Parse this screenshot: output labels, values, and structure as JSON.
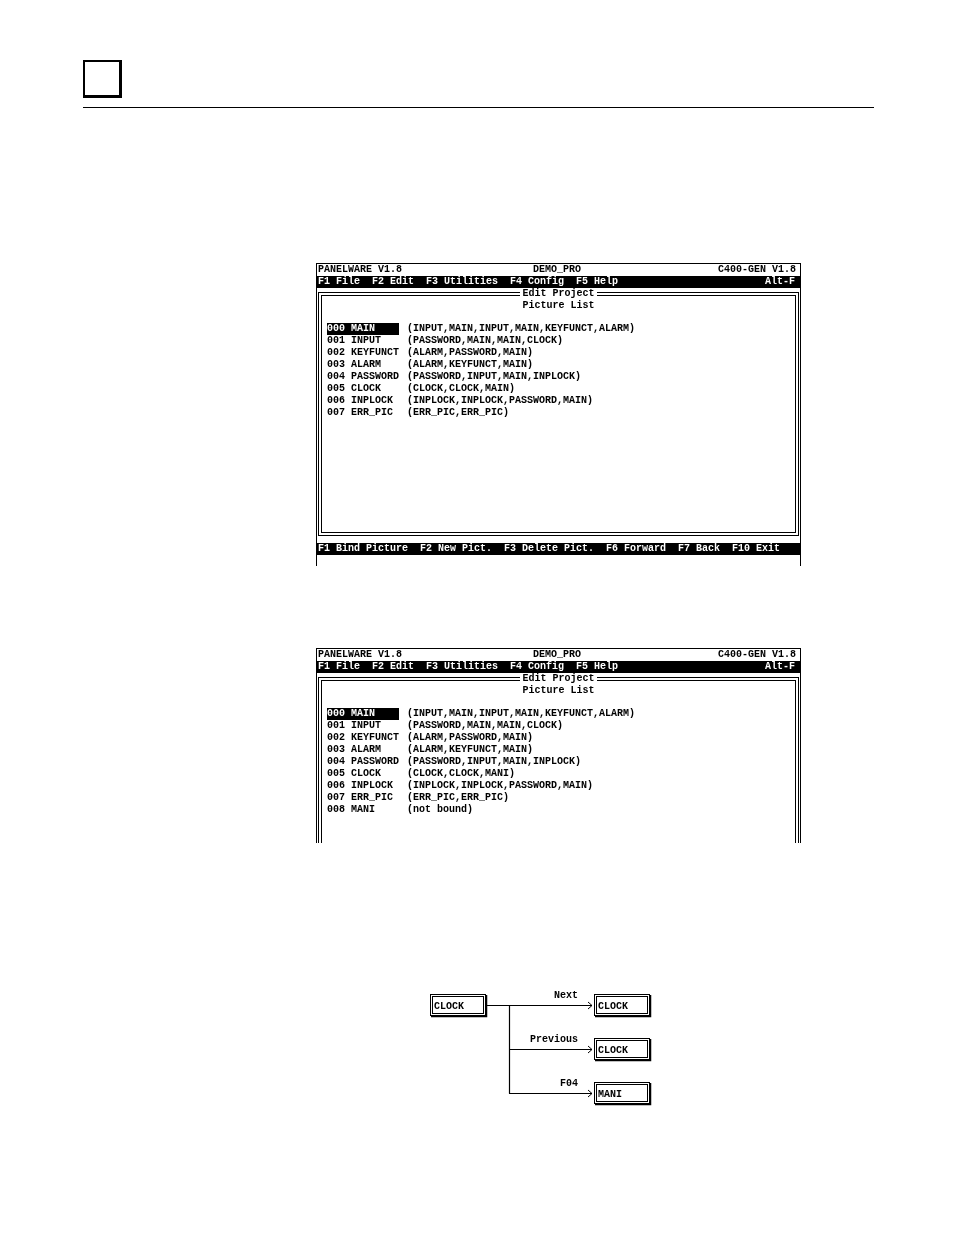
{
  "screens": [
    {
      "title_bar": {
        "app": "PANELWARE V1.8",
        "project": "DEMO_PRO",
        "target": "C400-GEN V1.8"
      },
      "menu": {
        "items": [
          "F1 File",
          "F2 Edit",
          "F3 Utilities",
          "F4 Config",
          "F5 Help"
        ],
        "shortcut": "Alt-F"
      },
      "panel": {
        "title": "Edit Project",
        "heading": "Picture List",
        "pictures": [
          {
            "number": "000",
            "name": "MAIN",
            "links": "(INPUT,MAIN,INPUT,MAIN,KEYFUNCT,ALARM)",
            "selected": true
          },
          {
            "number": "001",
            "name": "INPUT",
            "links": "(PASSWORD,MAIN,MAIN,CLOCK)",
            "selected": false
          },
          {
            "number": "002",
            "name": "KEYFUNCT",
            "links": "(ALARM,PASSWORD,MAIN)",
            "selected": false
          },
          {
            "number": "003",
            "name": "ALARM",
            "links": "(ALARM,KEYFUNCT,MAIN)",
            "selected": false
          },
          {
            "number": "004",
            "name": "PASSWORD",
            "links": "(PASSWORD,INPUT,MAIN,INPLOCK)",
            "selected": false
          },
          {
            "number": "005",
            "name": "CLOCK",
            "links": "(CLOCK,CLOCK,MAIN)",
            "selected": false
          },
          {
            "number": "006",
            "name": "INPLOCK",
            "links": "(INPLOCK,INPLOCK,PASSWORD,MAIN)",
            "selected": false
          },
          {
            "number": "007",
            "name": "ERR_PIC",
            "links": "(ERR_PIC,ERR_PIC)",
            "selected": false
          }
        ]
      },
      "function_keys": [
        "F1 Bind Picture",
        "F2 New Pict.",
        "F3 Delete Pict.",
        "F6 Forward",
        "F7 Back",
        "F10 Exit"
      ]
    },
    {
      "title_bar": {
        "app": "PANELWARE V1.8",
        "project": "DEMO_PRO",
        "target": "C400-GEN V1.8"
      },
      "menu": {
        "items": [
          "F1 File",
          "F2 Edit",
          "F3 Utilities",
          "F4 Config",
          "F5 Help"
        ],
        "shortcut": "Alt-F"
      },
      "panel": {
        "title": "Edit Project",
        "heading": "Picture List",
        "pictures": [
          {
            "number": "000",
            "name": "MAIN",
            "links": "(INPUT,MAIN,INPUT,MAIN,KEYFUNCT,ALARM)",
            "selected": true
          },
          {
            "number": "001",
            "name": "INPUT",
            "links": "(PASSWORD,MAIN,MAIN,CLOCK)",
            "selected": false
          },
          {
            "number": "002",
            "name": "KEYFUNCT",
            "links": "(ALARM,PASSWORD,MAIN)",
            "selected": false
          },
          {
            "number": "003",
            "name": "ALARM",
            "links": "(ALARM,KEYFUNCT,MAIN)",
            "selected": false
          },
          {
            "number": "004",
            "name": "PASSWORD",
            "links": "(PASSWORD,INPUT,MAIN,INPLOCK)",
            "selected": false
          },
          {
            "number": "005",
            "name": "CLOCK",
            "links": "(CLOCK,CLOCK,MANI)",
            "selected": false
          },
          {
            "number": "006",
            "name": "INPLOCK",
            "links": "(INPLOCK,INPLOCK,PASSWORD,MAIN)",
            "selected": false
          },
          {
            "number": "007",
            "name": "ERR_PIC",
            "links": "(ERR_PIC,ERR_PIC)",
            "selected": false
          },
          {
            "number": "008",
            "name": "MANI",
            "links": "(not bound)",
            "selected": false
          }
        ]
      }
    }
  ],
  "diagram": {
    "source": "CLOCK",
    "links": [
      {
        "label": "Next",
        "target": "CLOCK"
      },
      {
        "label": "Previous",
        "target": "CLOCK"
      },
      {
        "label": "F04",
        "target": "MANI"
      }
    ]
  }
}
